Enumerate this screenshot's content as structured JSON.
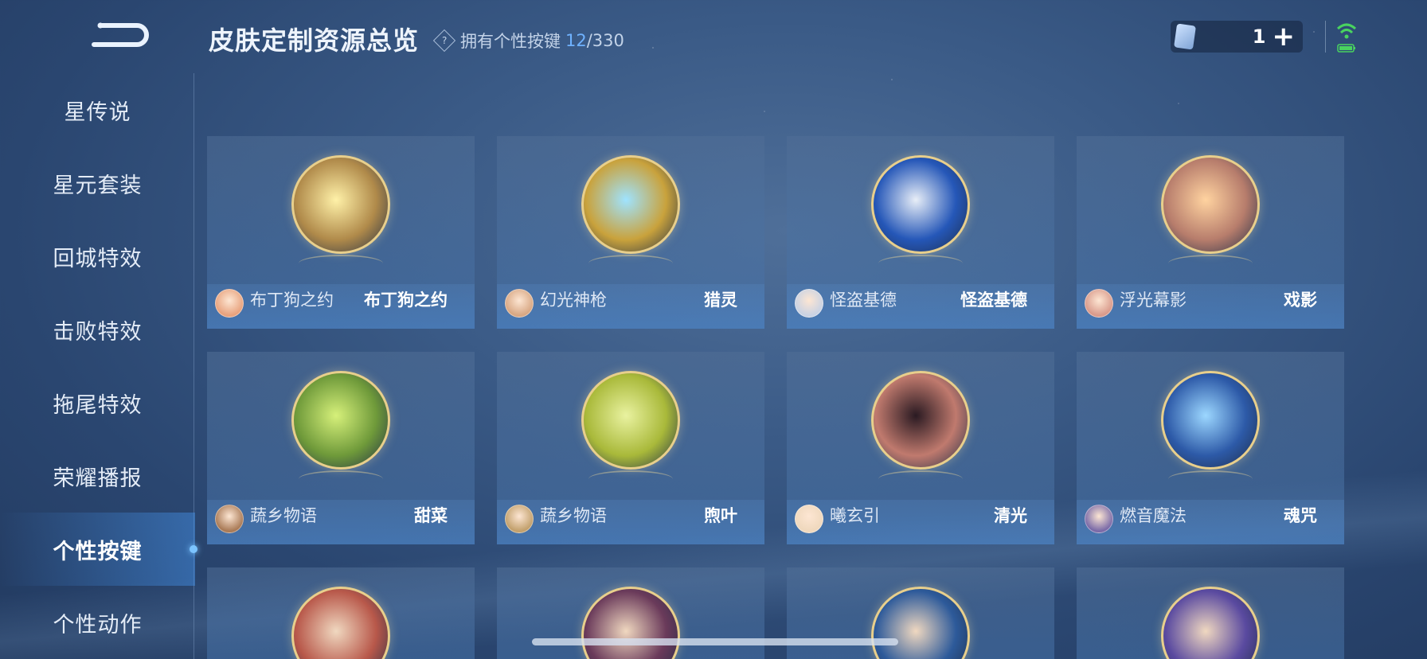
{
  "header": {
    "title": "皮肤定制资源总览",
    "owned_label": "拥有个性按键",
    "owned_count": "12",
    "owned_total": "/330",
    "currency_value": "1",
    "plus_label": "+"
  },
  "sidebar": {
    "items": [
      {
        "label": "星传说"
      },
      {
        "label": "星元套装"
      },
      {
        "label": "回城特效"
      },
      {
        "label": "击败特效"
      },
      {
        "label": "拖尾特效"
      },
      {
        "label": "荣耀播报"
      },
      {
        "label": "个性按键",
        "active": true
      },
      {
        "label": "个性动作"
      }
    ]
  },
  "cards": [
    {
      "skin": "布丁狗之约",
      "button": "布丁狗之约",
      "color": "#b08a4a",
      "accent": "#fff1a8",
      "avatar": "#e8a27d"
    },
    {
      "skin": "幻光神枪",
      "button": "猎灵",
      "color": "#c9a23c",
      "accent": "#9fe3ff",
      "avatar": "#d8a783"
    },
    {
      "skin": "怪盗基德",
      "button": "怪盗基德",
      "color": "#2557b8",
      "accent": "#e8eef7",
      "avatar": "#c9d2e3"
    },
    {
      "skin": "浮光幕影",
      "button": "戏影",
      "color": "#b77d6c",
      "accent": "#ffd3a0",
      "avatar": "#d99a8b"
    },
    {
      "skin": "蔬乡物语",
      "button": "甜菜",
      "color": "#6f9a3a",
      "accent": "#d6f07a",
      "avatar": "#a97a56"
    },
    {
      "skin": "蔬乡物语",
      "button": "煦叶",
      "color": "#a9b93a",
      "accent": "#e9f2a0",
      "avatar": "#c2a06c"
    },
    {
      "skin": "曦玄引",
      "button": "清光",
      "color": "#c07a6e",
      "accent": "#2a1a22",
      "avatar": "#efd8bd"
    },
    {
      "skin": "燃音魔法",
      "button": "魂咒",
      "color": "#2d5aa8",
      "accent": "#9cd7ff",
      "avatar": "#7a6aa8"
    }
  ],
  "peek_cards": [
    {
      "color": "#b8584a"
    },
    {
      "color": "#6a3a5a"
    },
    {
      "color": "#2d5a9a"
    },
    {
      "color": "#5a4aa0"
    }
  ]
}
